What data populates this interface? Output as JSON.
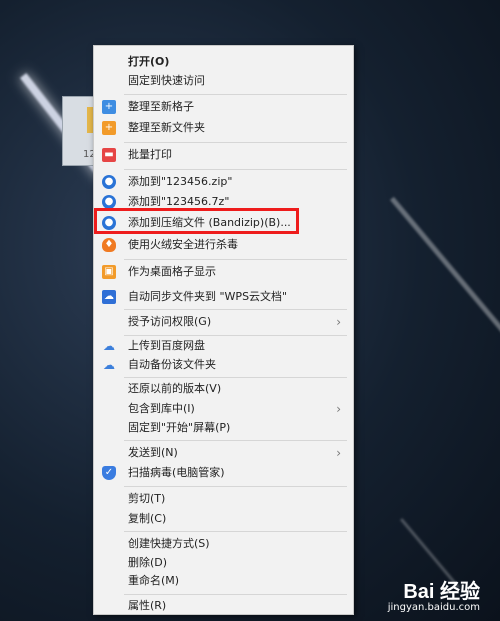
{
  "desktop": {
    "icon_label": "12"
  },
  "menu": {
    "items": [
      {
        "label": "打开(O)",
        "icon": "",
        "submenu": false
      },
      {
        "label": "固定到快速访问",
        "icon": "",
        "submenu": false
      },
      {
        "label": "整理至新格子",
        "icon": "fences-grid-icon",
        "submenu": false
      },
      {
        "label": "整理至新文件夹",
        "icon": "new-folder-icon",
        "submenu": false
      },
      {
        "label": "批量打印",
        "icon": "printer-icon",
        "submenu": false
      },
      {
        "label": "添加到\"123456.zip\"",
        "icon": "bandizip-icon",
        "submenu": false
      },
      {
        "label": "添加到\"123456.7z\"",
        "icon": "bandizip-icon",
        "submenu": false
      },
      {
        "label": "添加到压缩文件 (Bandizip)(B)...",
        "icon": "bandizip-icon",
        "submenu": false
      },
      {
        "label": "使用火绒安全进行杀毒",
        "icon": "huorong-icon",
        "submenu": false
      },
      {
        "label": "作为桌面格子显示",
        "icon": "desktop-grid-icon",
        "submenu": false
      },
      {
        "label": "自动同步文件夹到 \"WPS云文档\"",
        "icon": "wps-cloud-icon",
        "submenu": false
      },
      {
        "label": "授予访问权限(G)",
        "icon": "",
        "submenu": true
      },
      {
        "label": "上传到百度网盘",
        "icon": "baidu-netdisk-icon",
        "submenu": false
      },
      {
        "label": "自动备份该文件夹",
        "icon": "baidu-netdisk-icon",
        "submenu": false
      },
      {
        "label": "还原以前的版本(V)",
        "icon": "",
        "submenu": false
      },
      {
        "label": "包含到库中(I)",
        "icon": "",
        "submenu": true
      },
      {
        "label": "固定到\"开始\"屏幕(P)",
        "icon": "",
        "submenu": false
      },
      {
        "label": "发送到(N)",
        "icon": "",
        "submenu": true
      },
      {
        "label": "扫描病毒(电脑管家)",
        "icon": "pc-manager-shield-icon",
        "submenu": false
      },
      {
        "label": "剪切(T)",
        "icon": "",
        "submenu": false
      },
      {
        "label": "复制(C)",
        "icon": "",
        "submenu": false
      },
      {
        "label": "创建快捷方式(S)",
        "icon": "",
        "submenu": false
      },
      {
        "label": "删除(D)",
        "icon": "",
        "submenu": false
      },
      {
        "label": "重命名(M)",
        "icon": "",
        "submenu": false
      },
      {
        "label": "属性(R)",
        "icon": "",
        "submenu": false
      }
    ]
  },
  "watermark": {
    "brand": "Bai 经验",
    "url": "jingyan.baidu.com"
  },
  "colors": {
    "highlight": "#ee1c1c",
    "menu_bg": "#f2f2f2"
  }
}
